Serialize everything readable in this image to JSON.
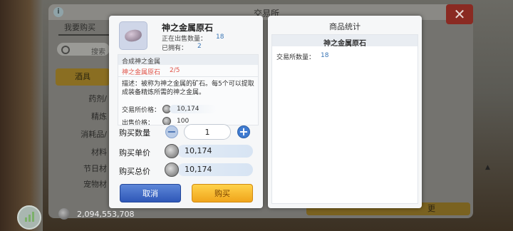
{
  "background": {
    "title": "交易所",
    "tab_buy": "我要购买",
    "search_placeholder": "搜索",
    "categories": [
      "药剂/",
      "精炼",
      "消耗品/",
      "材料",
      "节日材",
      "宠物材"
    ],
    "first_category": "酒具",
    "money": "2,094,553,708",
    "right_button_label": "更"
  },
  "dialog": {
    "item_name": "神之金属原石",
    "on_sale_label": "正在出售数量：",
    "on_sale_value": "18",
    "owned_label": "已拥有：",
    "owned_value": "2",
    "compose_title": "合成神之金属",
    "compose_item": "神之金属原石",
    "compose_count": "2/5",
    "description": "描述：被称为神之金属的矿石。每5个可以提取成装备精炼所需的神之金属。",
    "exchange_price_label": "交易所价格：",
    "exchange_price_value": "10,174",
    "sell_price_label": "出售价格：",
    "sell_price_value": "100",
    "quantity_label": "购买数量",
    "quantity_value": "1",
    "unit_price_label": "购买单价",
    "unit_price_value": "10,174",
    "total_price_label": "购买总价",
    "total_price_value": "10,174",
    "cancel_label": "取消",
    "buy_label": "购买"
  },
  "stats": {
    "title": "商品统计",
    "item_name": "神之金属原石",
    "qty_label": "交易所数量：",
    "qty_value": "18"
  },
  "colors": {
    "accent_blue": "#3a76b5",
    "warning_red": "#e0554a",
    "buy_button": "#f0a51c",
    "cancel_button": "#2f58b8"
  }
}
